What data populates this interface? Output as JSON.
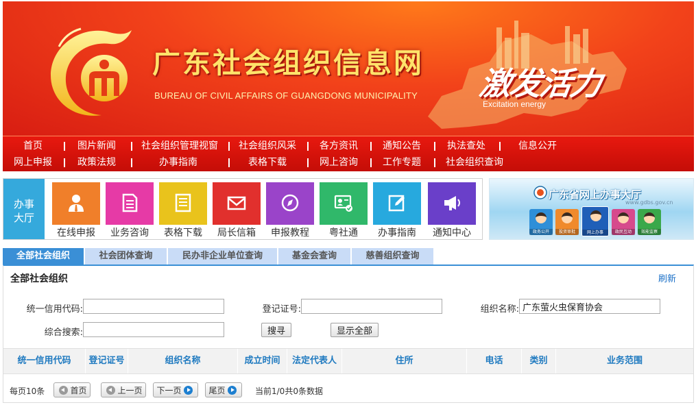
{
  "header": {
    "title": "广东社会组织信息网",
    "subtitle": "BUREAU OF CIVIL AFFAIRS OF GUANGDONG MUNICIPALITY",
    "slogan": "激发活力",
    "slogan_en": "Excitation energy"
  },
  "nav": {
    "row1": [
      "首页",
      "图片新闻",
      "社会组织管理视窗",
      "社会组织风采",
      "各方资讯",
      "通知公告",
      "执法查处",
      "信息公开"
    ],
    "row2": [
      "网上申报",
      "政策法规",
      "办事指南",
      "表格下载",
      "网上咨询",
      "工作专题",
      "社会组织查询"
    ]
  },
  "service_hall": {
    "label_line1": "办事",
    "label_line2": "大厅",
    "tiles": [
      {
        "label": "在线申报",
        "icon": "user-icon",
        "color": "#f07f2a"
      },
      {
        "label": "业务咨询",
        "icon": "document-icon",
        "color": "#e63aa6"
      },
      {
        "label": "表格下载",
        "icon": "form-icon",
        "color": "#e9c31c"
      },
      {
        "label": "局长信箱",
        "icon": "mail-icon",
        "color": "#e1302d"
      },
      {
        "label": "申报教程",
        "icon": "compass-icon",
        "color": "#9a44c9"
      },
      {
        "label": "粤社通",
        "icon": "id-card-icon",
        "color": "#30b86a"
      },
      {
        "label": "办事指南",
        "icon": "edit-icon",
        "color": "#27a9de"
      },
      {
        "label": "通知中心",
        "icon": "megaphone-icon",
        "color": "#6a3fc9"
      }
    ]
  },
  "right_banner": {
    "title": "广东省网上办事大厅",
    "url": "www.gdbs.gov.cn",
    "cards": [
      {
        "caption": "政务公开",
        "color": "#2f8fd8"
      },
      {
        "caption": "投资审批",
        "color": "#f08a2c"
      },
      {
        "caption": "网上办事",
        "color": "#1f5fb8"
      },
      {
        "caption": "政民互动",
        "color": "#d64a8c"
      },
      {
        "caption": "效能监察",
        "color": "#3aa84a"
      }
    ]
  },
  "tabs": [
    "全部社会组织",
    "社会团体查询",
    "民办非企业单位查询",
    "基金会查询",
    "慈善组织查询"
  ],
  "panel": {
    "title": "全部社会组织",
    "refresh": "刷新",
    "fields": {
      "credit_code_label": "统一信用代码:",
      "credit_code_value": "",
      "reg_no_label": "登记证号:",
      "reg_no_value": "",
      "org_name_label": "组织名称:",
      "org_name_value": "广东萤火虫保育协会",
      "search_label": "综合搜索:",
      "search_value": ""
    },
    "search_button": "搜寻",
    "show_all_button": "显示全部",
    "columns": [
      "统一信用代码",
      "登记证号",
      "组织名称",
      "成立时间",
      "法定代表人",
      "住所",
      "电话",
      "类别",
      "业务范围"
    ]
  },
  "pager": {
    "per_page": "每页10条",
    "first": "首页",
    "prev": "上一页",
    "next": "下一页",
    "last": "尾页",
    "status": "当前1/0共0条数据"
  },
  "colors": {
    "nav_red": "#d8140c",
    "hall_blue": "#35a9dc",
    "tab_active": "#3a8fd6",
    "tab_idle": "#c9dcf7",
    "header_link": "#1f7ac0"
  }
}
